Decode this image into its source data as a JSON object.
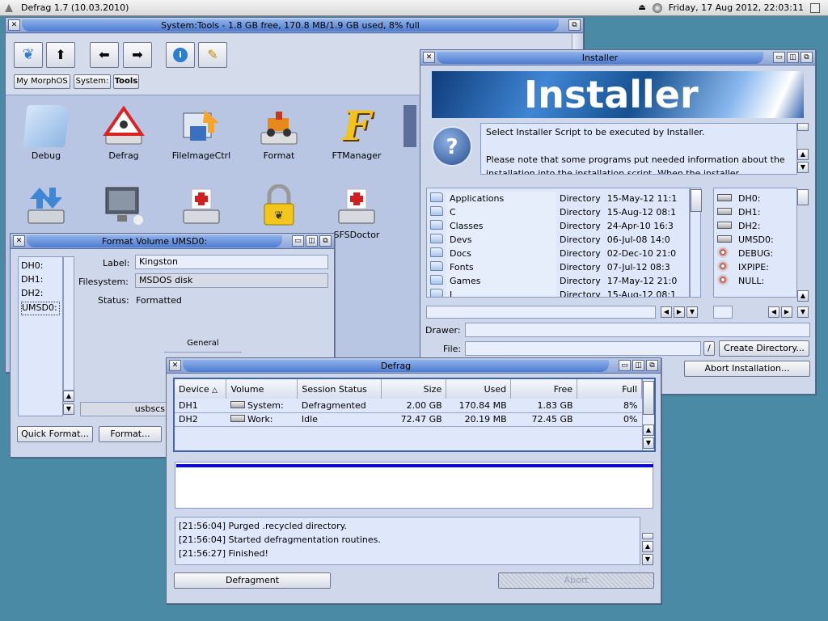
{
  "menubar": {
    "app_title": "Defrag 1.7 (10.03.2010)",
    "datetime": "Friday, 17 Aug 2012, 22:03:11"
  },
  "drawer": {
    "title": "System:Tools - 1.8 GB free, 170.8 MB/1.9 GB used, 8% full",
    "breadcrumbs": [
      "My MorphOS",
      "System:",
      "Tools"
    ],
    "icons": [
      "Debug",
      "Defrag",
      "FileImageCtrl",
      "Format",
      "FTManager",
      "",
      "",
      "",
      "",
      "",
      "SFSDoctor"
    ]
  },
  "installer": {
    "title": "Installer",
    "banner": "Installer",
    "message_line1": "Select Installer Script to be executed by Installer.",
    "message_line2": "Please note that some programs put needed information about the",
    "message_line3": "installation into the installation script. When the installer ...",
    "files": [
      {
        "name": "Applications",
        "type": "Directory",
        "date": "15-May-12 11:1"
      },
      {
        "name": "C",
        "type": "Directory",
        "date": "15-Aug-12 08:1"
      },
      {
        "name": "Classes",
        "type": "Directory",
        "date": "24-Apr-10 16:3"
      },
      {
        "name": "Devs",
        "type": "Directory",
        "date": "06-Jul-08 14:0"
      },
      {
        "name": "Docs",
        "type": "Directory",
        "date": "02-Dec-10 21:0"
      },
      {
        "name": "Fonts",
        "type": "Directory",
        "date": "07-Jul-12 08:3"
      },
      {
        "name": "Games",
        "type": "Directory",
        "date": "17-May-12 21:0"
      },
      {
        "name": "L",
        "type": "Directory",
        "date": "15-Aug-12 08:1"
      }
    ],
    "volumes": [
      "DH0:",
      "DH1:",
      "DH2:",
      "UMSD0:",
      "DEBUG:",
      "IXPIPE:",
      "NULL:"
    ],
    "drawer_label": "Drawer:",
    "file_label": "File:",
    "slash": "/",
    "create_dir": "Create Directory...",
    "abort": "Abort Installation..."
  },
  "format": {
    "title": "Format Volume UMSD0:",
    "devices": [
      "DH0:",
      "DH1:",
      "DH2:",
      "UMSD0:"
    ],
    "label_caption": "Label:",
    "label_value": "Kingston",
    "fs_caption": "Filesystem:",
    "fs_value": "MSDOS disk",
    "status_caption": "Status:",
    "status_value": "Formatted",
    "general_tab": "General",
    "device_name": "usbscs",
    "quick_format": "Quick Format...",
    "format": "Format..."
  },
  "defrag": {
    "title": "Defrag",
    "columns": [
      "Device",
      "Volume",
      "Session Status",
      "Size",
      "Used",
      "Free",
      "Full"
    ],
    "rows": [
      {
        "device": "DH1",
        "volume": "System:",
        "status": "Defragmented",
        "size": "2.00 GB",
        "used": "170.84 MB",
        "free": "1.83 GB",
        "full": "8%"
      },
      {
        "device": "DH2",
        "volume": "Work:",
        "status": "Idle",
        "size": "72.47 GB",
        "used": "20.19 MB",
        "free": "72.45 GB",
        "full": "0%"
      }
    ],
    "log": [
      "[21:56:04] Purged .recycled directory.",
      "[21:56:04] Started defragmentation routines.",
      "[21:56:27] Finished!"
    ],
    "defragment": "Defragment",
    "abort": "Abort",
    "map_fill": 1.0
  }
}
